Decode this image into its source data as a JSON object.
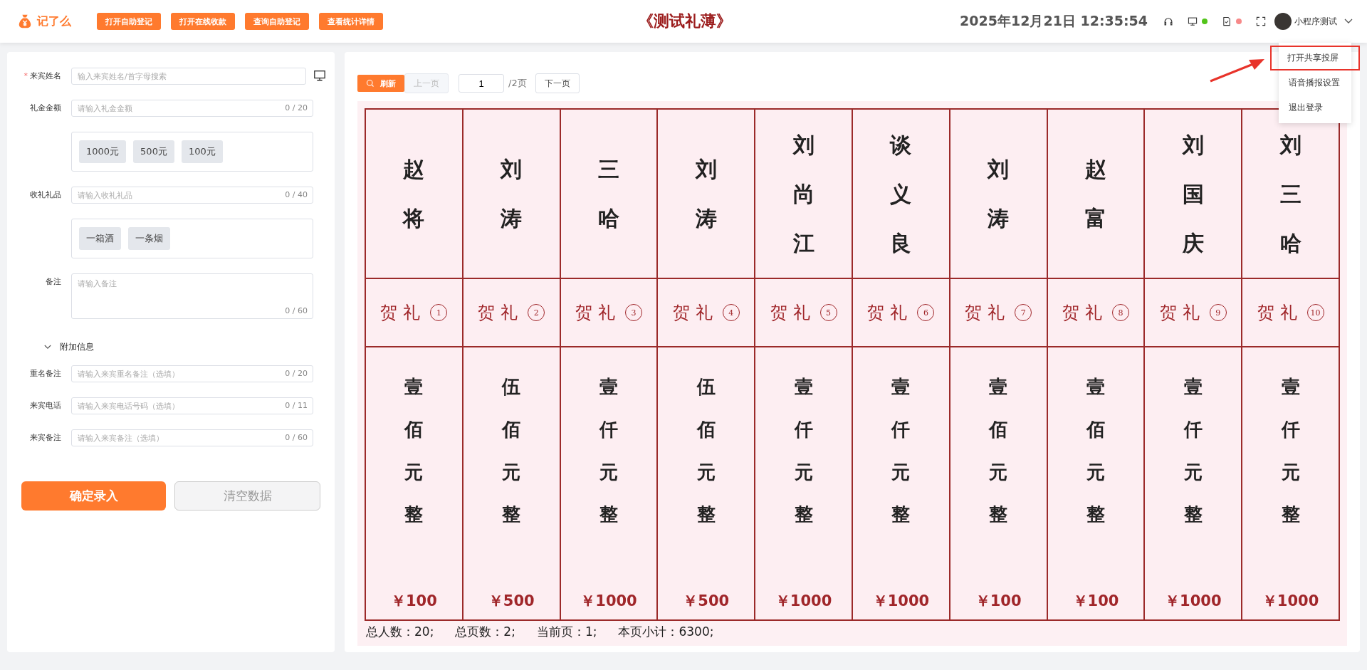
{
  "header": {
    "app_name": "记了么",
    "actions": [
      "打开自助登记",
      "打开在线收款",
      "查询自助登记",
      "查看统计详情"
    ],
    "title": "《测试礼薄》",
    "datetime": "2025年12月21日 12:35:54",
    "status_icons": [
      {
        "kind": "headset"
      },
      {
        "kind": "monitor",
        "color": "#52c41a"
      },
      {
        "kind": "document",
        "color": "#f78989"
      },
      {
        "kind": "fullscreen"
      }
    ],
    "user": {
      "name": "小程序测试"
    }
  },
  "user_menu": [
    {
      "label": "打开共享投屏",
      "highlighted": true
    },
    {
      "label": "语音播报设置",
      "highlighted": false
    },
    {
      "label": "退出登录",
      "highlighted": false
    }
  ],
  "form": {
    "rows": [
      {
        "kind": "search",
        "label": "来宾姓名",
        "required_mark": "*",
        "placeholder": "输入来宾姓名/首字母搜索"
      },
      {
        "kind": "input",
        "label": "礼金金额",
        "placeholder": "请输入礼金金额",
        "counter": "0 / 20"
      },
      {
        "kind": "chips",
        "chips": [
          "1000元",
          "500元",
          "100元"
        ]
      },
      {
        "kind": "input",
        "label": "收礼礼品",
        "placeholder": "请输入收礼礼品",
        "counter": "0 / 40"
      },
      {
        "kind": "chips",
        "chips": [
          "一箱酒",
          "一条烟"
        ]
      },
      {
        "kind": "textarea",
        "label": "备注",
        "placeholder": "请输入备注",
        "counter": "0 / 60"
      },
      {
        "kind": "toggle",
        "label": "附加信息",
        "expanded": true
      },
      {
        "kind": "input",
        "label": "重名备注",
        "placeholder": "请输入来宾重名备注（选填）",
        "counter": "0 / 20"
      },
      {
        "kind": "input",
        "label": "来宾电话",
        "placeholder": "请输入来宾电话号码（选填）",
        "counter": "0 / 11"
      },
      {
        "kind": "input",
        "label": "来宾备注",
        "placeholder": "请输入来宾备注（选填）",
        "counter": "0 / 60"
      }
    ],
    "submit": "确定录入",
    "clear": "清空数据"
  },
  "pager": {
    "refresh": "刷新",
    "prev": {
      "label": "上一页",
      "disabled": true
    },
    "page": "1",
    "total": "/2页",
    "next": "下一页"
  },
  "ledger": [
    {
      "name": "赵将",
      "label": "贺礼",
      "index": "1",
      "amount_words": "壹佰元整",
      "amount": "￥100"
    },
    {
      "name": "刘涛",
      "label": "贺礼",
      "index": "2",
      "amount_words": "伍佰元整",
      "amount": "￥500"
    },
    {
      "name": "三哈",
      "label": "贺礼",
      "index": "3",
      "amount_words": "壹仟元整",
      "amount": "￥1000"
    },
    {
      "name": "刘涛",
      "label": "贺礼",
      "index": "4",
      "amount_words": "伍佰元整",
      "amount": "￥500"
    },
    {
      "name": "刘尚江",
      "label": "贺礼",
      "index": "5",
      "amount_words": "壹仟元整",
      "amount": "￥1000"
    },
    {
      "name": "谈义良",
      "label": "贺礼",
      "index": "6",
      "amount_words": "壹仟元整",
      "amount": "￥1000"
    },
    {
      "name": "刘涛",
      "label": "贺礼",
      "index": "7",
      "amount_words": "壹佰元整",
      "amount": "￥100"
    },
    {
      "name": "赵富",
      "label": "贺礼",
      "index": "8",
      "amount_words": "壹佰元整",
      "amount": "￥100"
    },
    {
      "name": "刘国庆",
      "label": "贺礼",
      "index": "9",
      "amount_words": "壹仟元整",
      "amount": "￥1000"
    },
    {
      "name": "刘三哈",
      "label": "贺礼",
      "index": "10",
      "amount_words": "壹仟元整",
      "amount": "￥1000"
    }
  ],
  "summary": [
    "总人数：20;",
    "总页数：2;",
    "当前页：1;",
    "本页小计：6300;"
  ]
}
